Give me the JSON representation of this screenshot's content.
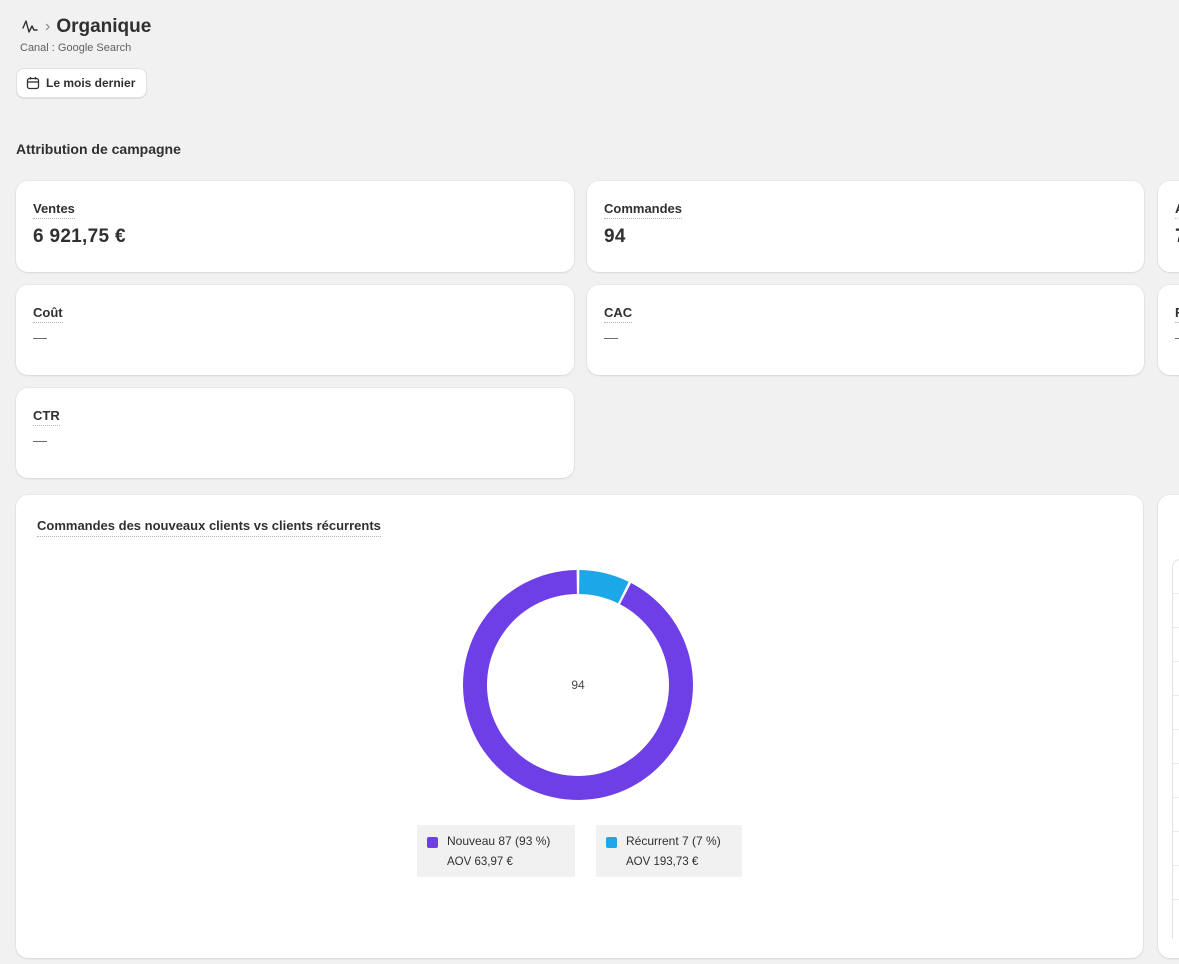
{
  "header": {
    "title": "Organique",
    "separator": "›",
    "subtitle": "Canal : Google Search"
  },
  "date_button": {
    "label": "Le mois dernier",
    "icon": "calendar-icon"
  },
  "section": {
    "title": "Attribution de campagne"
  },
  "metrics": {
    "ventes": {
      "label": "Ventes",
      "value": "6 921,75 €"
    },
    "commandes": {
      "label": "Commandes",
      "value": "94"
    },
    "third_partial": {
      "label": "A",
      "value": "7"
    },
    "cout": {
      "label": "Coût",
      "value": "—"
    },
    "cac": {
      "label": "CAC",
      "value": "—"
    },
    "sixth_partial": {
      "label": "F",
      "value": "—"
    },
    "ctr": {
      "label": "CTR",
      "value": "—"
    }
  },
  "chart": {
    "title": "Commandes des nouveaux clients vs clients récurrents",
    "center_label": "94"
  },
  "chart_data": {
    "type": "pie",
    "categories": [
      "Nouveau",
      "Récurrent"
    ],
    "values": [
      87,
      7
    ],
    "percent": [
      93,
      7
    ],
    "total": 94,
    "colors": [
      "#6e3fe6",
      "#1ba7e8"
    ],
    "legend": [
      {
        "label": "Nouveau 87 (93 %)",
        "aov": "AOV 63,97 €",
        "color": "#6e3fe6"
      },
      {
        "label": "Récurrent 7 (7 %)",
        "aov": "AOV 193,73 €",
        "color": "#1ba7e8"
      }
    ]
  }
}
